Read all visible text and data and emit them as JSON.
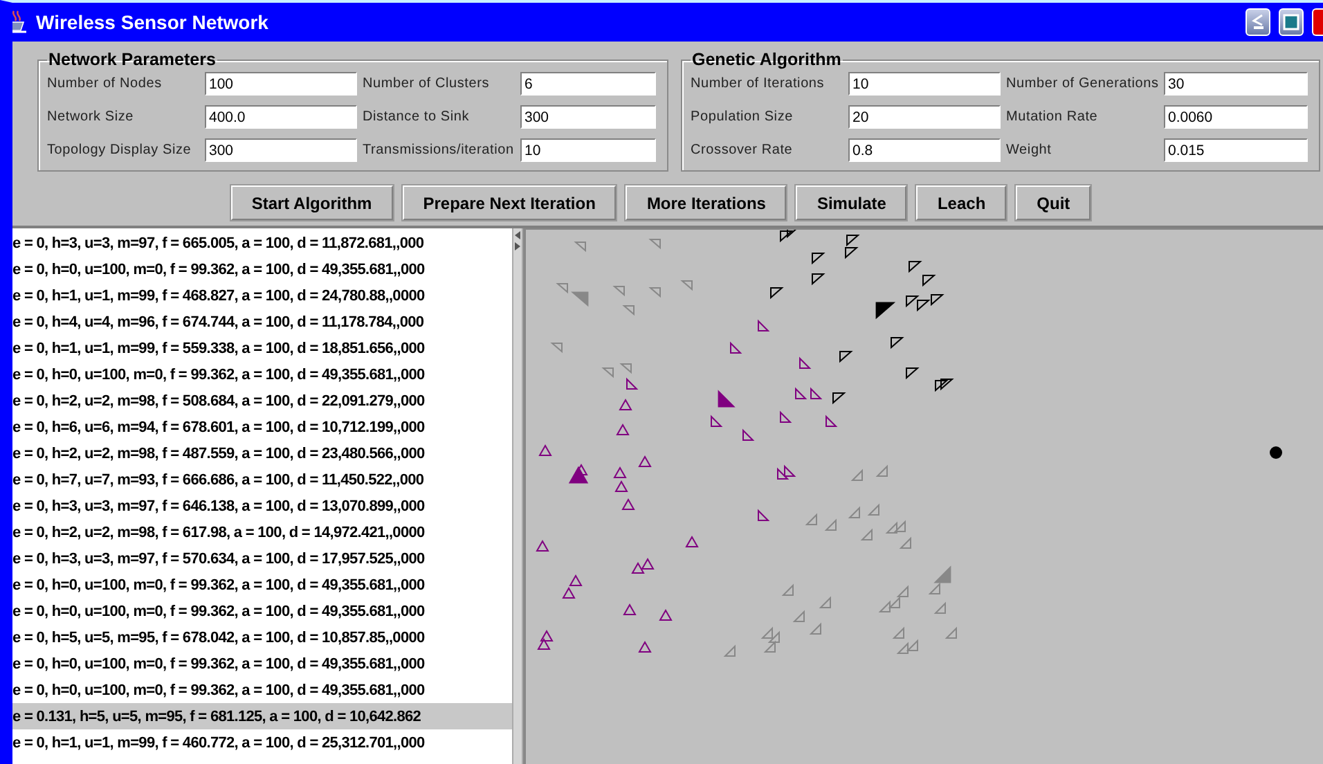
{
  "window": {
    "title": "Wireless Sensor Network"
  },
  "network_parameters": {
    "title": "Network Parameters",
    "fields": [
      {
        "label": "Number of Nodes",
        "value": "100"
      },
      {
        "label": "Number of Clusters",
        "value": "6"
      },
      {
        "label": "Network Size",
        "value": "400.0"
      },
      {
        "label": "Distance to Sink",
        "value": "300"
      },
      {
        "label": "Topology Display Size",
        "value": "300"
      },
      {
        "label": "Transmissions/iteration",
        "value": "10"
      }
    ]
  },
  "genetic_algorithm": {
    "title": "Genetic Algorithm",
    "fields": [
      {
        "label": "Number of Iterations",
        "value": "10"
      },
      {
        "label": "Number of Generations",
        "value": "30"
      },
      {
        "label": "Population Size",
        "value": "20"
      },
      {
        "label": "Mutation Rate",
        "value": "0.0060"
      },
      {
        "label": "Crossover Rate",
        "value": "0.8"
      },
      {
        "label": "Weight",
        "value": "0.015"
      }
    ]
  },
  "buttons": [
    "Start Algorithm",
    "Prepare Next Iteration",
    "More Iterations",
    "Simulate",
    "Leach",
    "Quit"
  ],
  "results": {
    "rows": [
      {
        "text": "e = 0, h=3, u=3, m=97, f = 665.005, a = 100, d = 11,872.681,,000",
        "selected": false
      },
      {
        "text": "e = 0, h=0, u=100, m=0, f = 99.362, a = 100, d = 49,355.681,,000",
        "selected": false
      },
      {
        "text": "e = 0, h=1, u=1, m=99, f = 468.827, a = 100, d = 24,780.88,,0000",
        "selected": false
      },
      {
        "text": "e = 0, h=4, u=4, m=96, f = 674.744, a = 100, d = 11,178.784,,000",
        "selected": false
      },
      {
        "text": "e = 0, h=1, u=1, m=99, f = 559.338, a = 100, d = 18,851.656,,000",
        "selected": false
      },
      {
        "text": "e = 0, h=0, u=100, m=0, f = 99.362, a = 100, d = 49,355.681,,000",
        "selected": false
      },
      {
        "text": "e = 0, h=2, u=2, m=98, f = 508.684, a = 100, d = 22,091.279,,000",
        "selected": false
      },
      {
        "text": "e = 0, h=6, u=6, m=94, f = 678.601, a = 100, d = 10,712.199,,000",
        "selected": false
      },
      {
        "text": "e = 0, h=2, u=2, m=98, f = 487.559, a = 100, d = 23,480.566,,000",
        "selected": false
      },
      {
        "text": "e = 0, h=7, u=7, m=93, f = 666.686, a = 100, d = 11,450.522,,000",
        "selected": false
      },
      {
        "text": "e = 0, h=3, u=3, m=97, f = 646.138, a = 100, d = 13,070.899,,000",
        "selected": false
      },
      {
        "text": "e = 0, h=2, u=2, m=98, f = 617.98, a = 100, d = 14,972.421,,0000",
        "selected": false
      },
      {
        "text": "e = 0, h=3, u=3, m=97, f = 570.634, a = 100, d = 17,957.525,,000",
        "selected": false
      },
      {
        "text": "e = 0, h=0, u=100, m=0, f = 99.362, a = 100, d = 49,355.681,,000",
        "selected": false
      },
      {
        "text": "e = 0, h=0, u=100, m=0, f = 99.362, a = 100, d = 49,355.681,,000",
        "selected": false
      },
      {
        "text": "e = 0, h=5, u=5, m=95, f = 678.042, a = 100, d = 10,857.85,,0000",
        "selected": false
      },
      {
        "text": "e = 0, h=0, u=100, m=0, f = 99.362, a = 100, d = 49,355.681,,000",
        "selected": false
      },
      {
        "text": "e = 0, h=0, u=100, m=0, f = 99.362, a = 100, d = 49,355.681,,000",
        "selected": false
      },
      {
        "text": "e = 0.131, h=5, u=5, m=95, f = 681.125, a = 100, d = 10,642.862",
        "selected": true
      },
      {
        "text": "e = 0, h=1, u=1, m=99, f = 460.772, a = 100, d = 25,312.701,,000",
        "selected": false
      }
    ]
  }
}
